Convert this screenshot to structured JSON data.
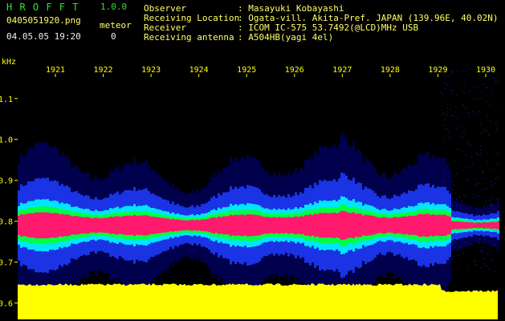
{
  "app": {
    "name": "H R O F F T",
    "version": "1.0.0",
    "filename": "0405051920.png",
    "datetime": "04.05.05 19:20",
    "meteor_label": "meteor",
    "meteor_count": "0"
  },
  "info": {
    "observer_label": "Observer",
    "observer_value": ": Masayuki Kobayashi",
    "location_label": "Receiving Location",
    "location_value": ": Ogata-vill. Akita-Pref. JAPAN (139.96E, 40.02N)",
    "receiver_label": "Receiver",
    "receiver_value": ": ICOM IC-575 53.7492(@LCD)MHz USB",
    "antenna_label": "Receiving antenna",
    "antenna_value": ": A504HB(yagi 4el)"
  },
  "chart_data": {
    "type": "heatmap",
    "ylabel": "kHz",
    "yticks": [
      "1.1",
      "1.0",
      "0.9",
      "0.8",
      "0.7",
      "0.6"
    ],
    "ytick_values": [
      1.1,
      1.0,
      0.9,
      0.8,
      0.7,
      0.6
    ],
    "xticks": [
      "1921",
      "1922",
      "1923",
      "1924",
      "1925",
      "1926",
      "1927",
      "1928",
      "1929",
      "1930"
    ],
    "ylim": [
      0.56,
      1.18
    ],
    "signal_center_khz": 0.79,
    "colors": {
      "background": "#000000",
      "noise_low": "#00008b",
      "noise_mid": "#1e3cff",
      "cyan": "#00e5ff",
      "green": "#00ff40",
      "signal": "#ff1a6e",
      "floor": "#ffff00",
      "tick": "#ffff00"
    }
  }
}
